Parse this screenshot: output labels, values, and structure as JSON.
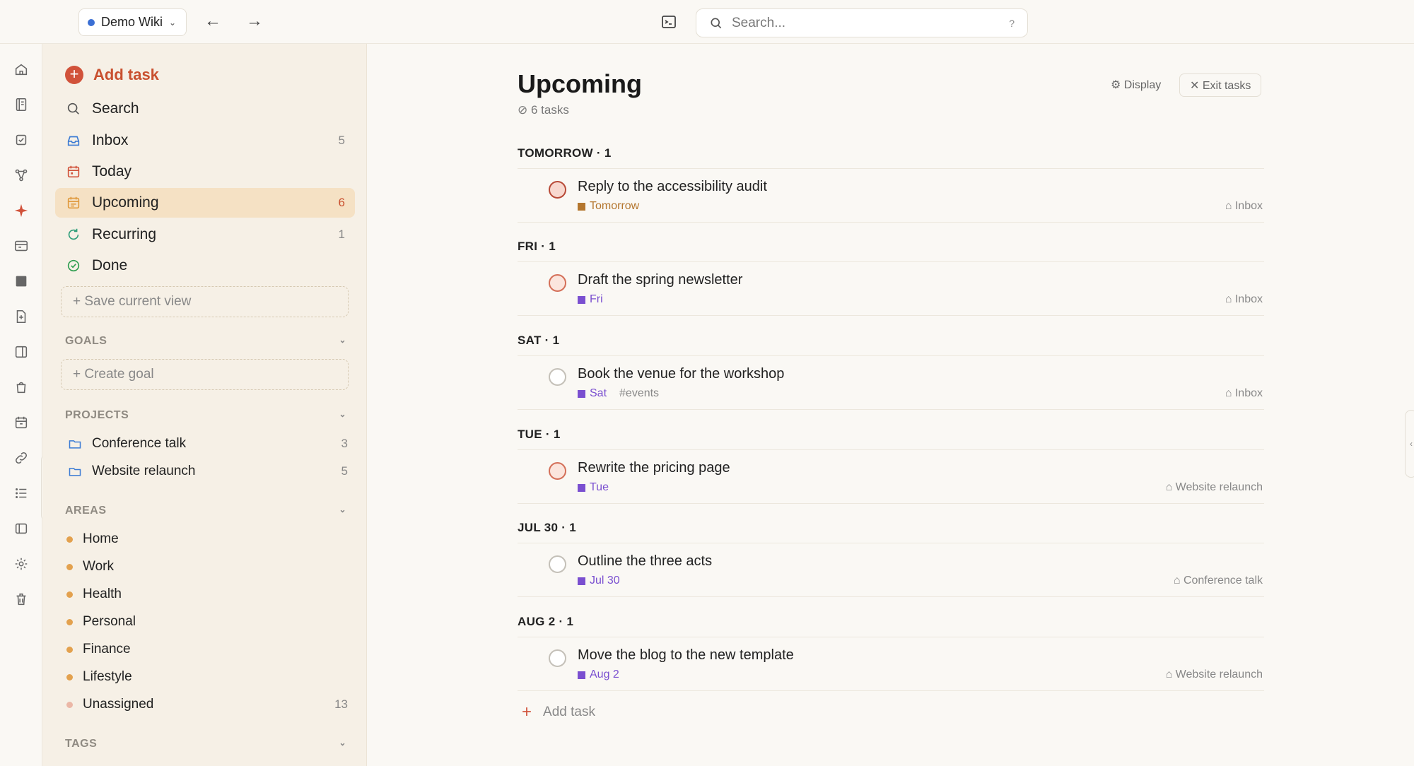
{
  "topbar": {
    "wiki_name": "Demo Wiki",
    "search_placeholder": "Search...",
    "search_shortcut": "?"
  },
  "sidebar": {
    "add_task": "Add task",
    "nav": [
      {
        "label": "Search",
        "count": ""
      },
      {
        "label": "Inbox",
        "count": "5"
      },
      {
        "label": "Today",
        "count": ""
      },
      {
        "label": "Upcoming",
        "count": "6"
      },
      {
        "label": "Recurring",
        "count": "1"
      },
      {
        "label": "Done",
        "count": ""
      }
    ],
    "save_view": "+ Save current view",
    "goals_head": "GOALS",
    "create_goal": "+ Create goal",
    "projects_head": "PROJECTS",
    "projects": [
      {
        "label": "Conference talk",
        "count": "3"
      },
      {
        "label": "Website relaunch",
        "count": "5"
      }
    ],
    "areas_head": "AREAS",
    "areas": [
      {
        "label": "Home",
        "count": ""
      },
      {
        "label": "Work",
        "count": ""
      },
      {
        "label": "Health",
        "count": ""
      },
      {
        "label": "Personal",
        "count": ""
      },
      {
        "label": "Finance",
        "count": ""
      },
      {
        "label": "Lifestyle",
        "count": ""
      },
      {
        "label": "Unassigned",
        "count": "13"
      }
    ],
    "tags_head": "TAGS"
  },
  "main": {
    "title": "Upcoming",
    "task_count": "⊘ 6 tasks",
    "display_label": "⚙ Display",
    "exit_label": "✕ Exit tasks",
    "add_task": "Add task",
    "groups": [
      {
        "heading": "TOMORROW · 1",
        "task": {
          "title": "Reply to the accessibility audit",
          "date": "Tomorrow",
          "date_color": "#b4762e",
          "tag": "",
          "project": "⌂ Inbox",
          "priority": "p1"
        }
      },
      {
        "heading": "FRI · 1",
        "task": {
          "title": "Draft the spring newsletter",
          "date": "Fri",
          "date_color": "#7a4fd0",
          "tag": "",
          "project": "⌂ Inbox",
          "priority": "p2"
        }
      },
      {
        "heading": "SAT · 1",
        "task": {
          "title": "Book the venue for the workshop",
          "date": "Sat",
          "date_color": "#7a4fd0",
          "tag": "#events",
          "project": "⌂ Inbox",
          "priority": "none"
        }
      },
      {
        "heading": "TUE · 1",
        "task": {
          "title": "Rewrite the pricing page",
          "date": "Tue",
          "date_color": "#7a4fd0",
          "tag": "",
          "project": "⌂ Website relaunch",
          "priority": "p2"
        }
      },
      {
        "heading": "JUL 30 · 1",
        "task": {
          "title": "Outline the three acts",
          "date": "Jul 30",
          "date_color": "#7a4fd0",
          "tag": "",
          "project": "⌂ Conference talk",
          "priority": "none"
        }
      },
      {
        "heading": "AUG 2 · 1",
        "task": {
          "title": "Move the blog to the new template",
          "date": "Aug 2",
          "date_color": "#7a4fd0",
          "tag": "",
          "project": "⌂ Website relaunch",
          "priority": "none"
        }
      }
    ]
  },
  "colors": {
    "accent": "#d1523a",
    "active_bg": "#f5e1c4",
    "sidebar_bg": "#f6f0e6",
    "page_bg": "#faf8f4"
  }
}
